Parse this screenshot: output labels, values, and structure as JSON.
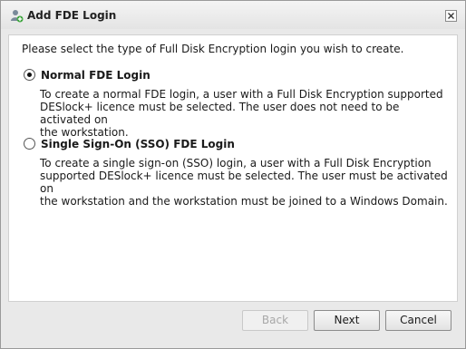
{
  "window": {
    "title": "Add FDE Login",
    "title_icon": "user-add-icon",
    "close_icon": "close-icon"
  },
  "content": {
    "intro": "Please select the type of Full Disk Encryption login you wish to create.",
    "options": [
      {
        "label": "Normal FDE Login",
        "selected": true,
        "desc_lines": [
          "To create a normal FDE login, a user with a Full Disk Encryption supported",
          "DESlock+ licence must be selected. The user does not need to be activated on",
          "the workstation."
        ]
      },
      {
        "label": "Single Sign-On (SSO) FDE Login",
        "selected": false,
        "desc_lines": [
          "To create a single sign-on (SSO) login, a user with a Full Disk Encryption",
          "supported DESlock+ licence must be selected. The user must be activated on",
          "the workstation and the workstation must be joined to a Windows Domain."
        ]
      }
    ]
  },
  "buttons": {
    "back": "Back",
    "next": "Next",
    "cancel": "Cancel"
  }
}
